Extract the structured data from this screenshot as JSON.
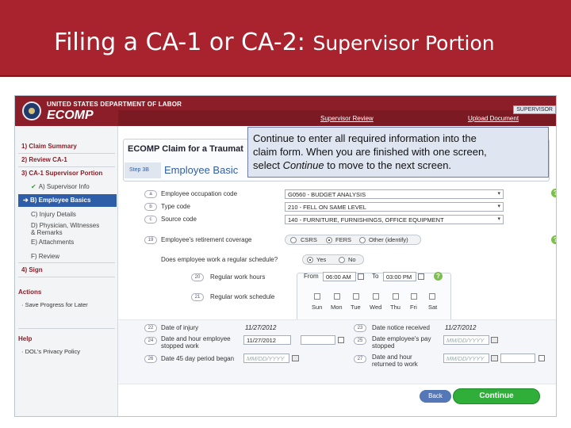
{
  "slide": {
    "title_main": "Filing a CA-1 or CA-2: ",
    "title_sub": "Supervisor Portion"
  },
  "header": {
    "department": "UNITED STATES DEPARTMENT OF LABOR",
    "app": "ECOMP",
    "role_badge": "SUPERVISOR",
    "links": [
      "Supervisor Review",
      "Upload Document"
    ]
  },
  "nav": {
    "items": [
      {
        "label": "1) Claim Summary"
      },
      {
        "label": "2) Review CA-1"
      },
      {
        "label": "3) CA-1 Supervisor Portion"
      }
    ],
    "subitems": [
      {
        "label": "A) Supervisor Info",
        "state": "done"
      },
      {
        "label": "B) Employee Basics",
        "state": "active"
      },
      {
        "label": "C) Injury Details",
        "state": ""
      },
      {
        "label": "D) Physician, Witnesses",
        "state": ""
      },
      {
        "label": "& Remarks",
        "state": ""
      },
      {
        "label": "E) Attachments",
        "state": ""
      },
      {
        "label": "F) Review",
        "state": ""
      }
    ],
    "sign": "4) Sign",
    "actions_title": "Actions",
    "actions_link": "· Save Progress for Later",
    "help_title": "Help",
    "help_link": "· DOL's Privacy Policy"
  },
  "main": {
    "claim_title": "ECOMP Claim for a Traumat",
    "step_tab": "Step 3B",
    "step_heading": "Employee Basic"
  },
  "callout": {
    "line1": "Continue to enter all required information into the",
    "line2": "claim form.  When you are finished with one screen,",
    "line3a": "select ",
    "line3b": "Continue",
    "line3c": " to move to the next screen."
  },
  "form": {
    "occupation": {
      "num": "a",
      "label": "Employee occupation code",
      "value": "G0560 - BUDGET ANALYSIS"
    },
    "type": {
      "num": "b",
      "label": "Type code",
      "value": "210 - FELL ON SAME LEVEL"
    },
    "source": {
      "num": "c",
      "label": "Source code",
      "value": "140 - FURNITURE, FURNISHINGS, OFFICE EQUIPMENT"
    },
    "retirement": {
      "num": "19",
      "label": "Employee's retirement coverage",
      "options": [
        "CSRS",
        "FERS",
        "Other (identify)"
      ],
      "selected": "FERS"
    },
    "regular": {
      "label": "Does employee work a regular schedule?",
      "options": [
        "Yes",
        "No"
      ],
      "selected": "Yes"
    },
    "hours": {
      "num": "20",
      "label": "Regular work hours",
      "from_label": "From",
      "from": "06:00 AM",
      "to_label": "To",
      "to": "03:00 PM"
    },
    "schedule": {
      "num": "21",
      "label": "Regular work schedule",
      "days": [
        "Sun",
        "Mon",
        "Tue",
        "Wed",
        "Thu",
        "Fri",
        "Sat"
      ]
    },
    "date_injury": {
      "num": "22",
      "label": "Date of injury",
      "value": "11/27/2012"
    },
    "date_stopped": {
      "num": "24",
      "label1": "Date and hour employee",
      "label2": "stopped work",
      "value": "11/27/2012"
    },
    "date_45": {
      "num": "26",
      "label": "Date 45 day period began",
      "placeholder": "MM/DD/YYYY"
    },
    "date_notice": {
      "num": "23",
      "label": "Date notice received",
      "value": "11/27/2012"
    },
    "date_pay": {
      "num": "25",
      "label1": "Date employee's pay",
      "label2": "stopped",
      "placeholder": "MM/DD/YYYY"
    },
    "date_return": {
      "num": "27",
      "label1": "Date and hour",
      "label2": "returned to work",
      "placeholder": "MM/DD/YYYY"
    }
  },
  "buttons": {
    "back": "Back",
    "continue": "Continue"
  }
}
